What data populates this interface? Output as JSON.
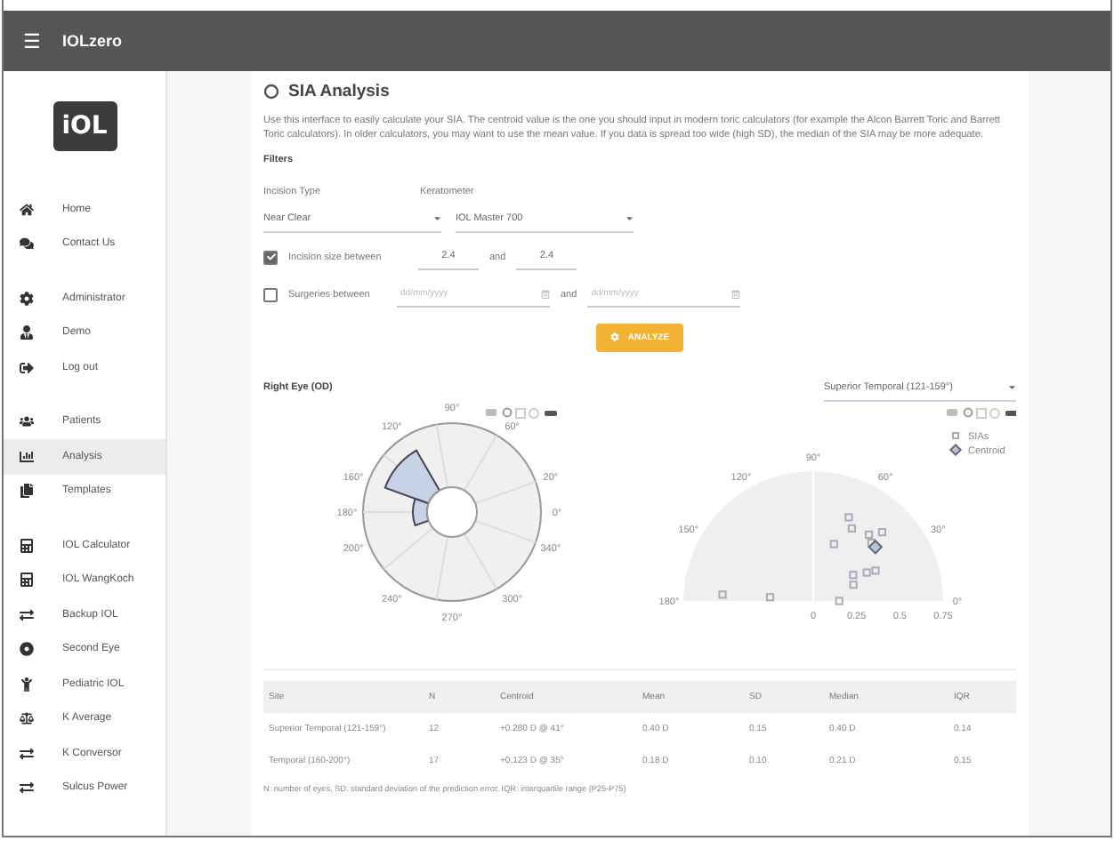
{
  "header": {
    "menu_glyph": "☰",
    "title": "IOLzero"
  },
  "logo": {
    "text": "iOL"
  },
  "sidebar": {
    "groups": [
      [
        {
          "label": "Home",
          "selected": false
        },
        {
          "label": "Contact Us",
          "selected": false
        }
      ],
      [
        {
          "label": "Administrator",
          "selected": false
        },
        {
          "label": "Demo",
          "selected": false
        },
        {
          "label": "Log out",
          "selected": false
        }
      ],
      [
        {
          "label": "Patients",
          "selected": false
        },
        {
          "label": "Analysis",
          "selected": true
        },
        {
          "label": "Templates",
          "selected": false
        }
      ],
      [
        {
          "label": "IOL Calculator",
          "selected": false
        },
        {
          "label": "IOL WangKoch",
          "selected": false
        },
        {
          "label": "Backup IOL",
          "selected": false
        },
        {
          "label": "Second Eye",
          "selected": false
        },
        {
          "label": "Pediatric IOL",
          "selected": false
        },
        {
          "label": "K Average",
          "selected": false
        },
        {
          "label": "K Conversor",
          "selected": false
        },
        {
          "label": "Sulcus Power",
          "selected": false
        }
      ]
    ]
  },
  "page": {
    "title": "SIA Analysis",
    "intro": "Use this interface to easily calculate your SIA. The centroid value is the one you should input in modern toric calculators (for example the Alcon Barrett Toric and Barrett Toric calculators). In older calculators, you may want to use the mean value. If you data is spread too wide (high SD), the median of the SIA may be more adequate."
  },
  "filters": {
    "heading": "Filters",
    "incision_type": {
      "label": "Incision Type",
      "value": "Near Clear"
    },
    "keratometer": {
      "label": "Keratometer",
      "value": "IOL Master 700"
    },
    "incision_size": {
      "checked": true,
      "label": "Incision size between",
      "from": "2.4",
      "joiner": "and",
      "to": "2.4"
    },
    "surgeries": {
      "checked": false,
      "label": "Surgeries between",
      "from_placeholder": "dd/mm/yyyy",
      "joiner": "and",
      "to_placeholder": "dd/mm/yyyy"
    },
    "analyze_button": "ANALYZE"
  },
  "results": {
    "eye_label": "Right Eye (OD)",
    "site_select": "Superior Temporal (121-159°)",
    "rose_chart": {
      "angle_labels": [
        "90°",
        "60°",
        "20°",
        "0°",
        "340°",
        "300°",
        "270°",
        "240°",
        "200°",
        "180°",
        "160°",
        "120°"
      ]
    },
    "scatter_chart": {
      "angle_labels": [
        "90°",
        "60°",
        "30°",
        "0°",
        "120°",
        "150°",
        "180°"
      ],
      "radial_labels": [
        "0",
        "0.25",
        "0.5",
        "0.75"
      ],
      "legend": [
        {
          "label": "SIAs",
          "kind": "point"
        },
        {
          "label": "Centroid",
          "kind": "centroid"
        }
      ]
    }
  },
  "table": {
    "columns": [
      "Site",
      "N",
      "Centroid",
      "Mean",
      "SD",
      "Median",
      "IQR"
    ],
    "rows": [
      [
        "Superior Temporal (121-159°)",
        "12",
        "+0.280 D @ 41°",
        "0.40 D",
        "0.15",
        "0.40 D",
        "0.14"
      ],
      [
        "Temporal (160-200°)",
        "17",
        "+0.123 D @ 35°",
        "0.18 D",
        "0.10",
        "0.21 D",
        "0.15"
      ]
    ],
    "footnote": "N: number of eyes, SD: standard deviation of the prediction error, IQR: interquartile range (P25-P75)"
  }
}
